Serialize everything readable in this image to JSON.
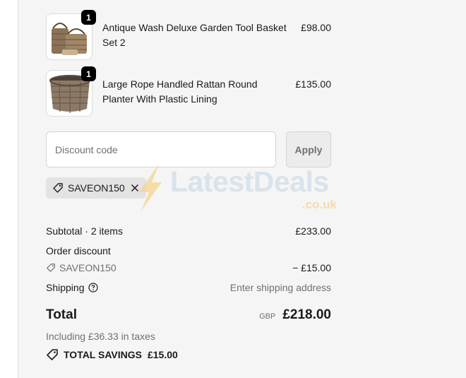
{
  "line_items": [
    {
      "quantity": "1",
      "title": "Antique Wash Deluxe Garden Tool Basket Set 2",
      "price": "£98.00",
      "image_icon": "wicker-basket-set-image"
    },
    {
      "quantity": "1",
      "title": "Large Rope Handled Rattan Round Planter With Plastic Lining",
      "price": "£135.00",
      "image_icon": "rattan-planter-image"
    }
  ],
  "discount": {
    "placeholder": "Discount code",
    "apply_label": "Apply",
    "applied_code": "SAVEON150"
  },
  "summary": {
    "subtotal_label": "Subtotal · 2 items",
    "subtotal_value": "£233.00",
    "order_discount_label": "Order discount",
    "discount_code": "SAVEON150",
    "discount_value": "− £15.00",
    "shipping_label": "Shipping",
    "shipping_value": "Enter shipping address",
    "total_label": "Total",
    "currency": "GBP",
    "total_value": "£218.00",
    "taxes_note": "Including £36.33 in taxes",
    "savings_label": "TOTAL SAVINGS",
    "savings_value": "£15.00"
  },
  "watermark": {
    "text": "LatestDeals",
    "subtext": ".co.uk"
  },
  "colors": {
    "panel_bg": "#f5f5f5",
    "chip_bg": "#e3e3e3",
    "muted_text": "#707070",
    "badge_bg": "#000000"
  }
}
